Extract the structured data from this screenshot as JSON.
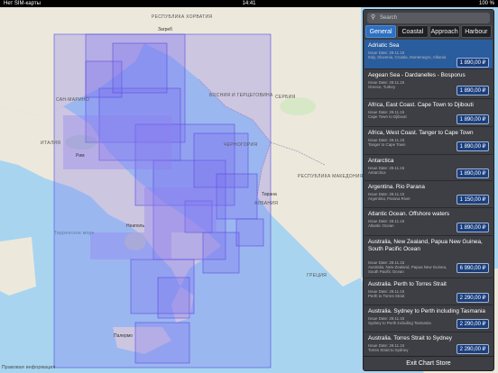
{
  "status_bar": {
    "carrier": "Нет SIM-карты",
    "time": "14:41",
    "battery": "100 %"
  },
  "map": {
    "countries": [
      "РЕСПУБЛИКА ХОРВАТИЯ",
      "БОСНИЯ И ГЕРЦЕГОВИНА",
      "СЕРБИЯ",
      "ИТАЛИЯ",
      "САН-МАРИНО",
      "ЧЕРНОГОРИЯ",
      "РЕСПУБЛИКА МАКЕДОНИЯ",
      "АЛБАНИЯ",
      "ГРЕЦИЯ"
    ],
    "cities": [
      "Загреб",
      "Рим",
      "Неаполь",
      "Тирана",
      "Палермо",
      "Тирренское море"
    ],
    "legal": "Правовая информация"
  },
  "panel": {
    "search_placeholder": "Search",
    "tabs": [
      "General",
      "Coastal",
      "Approach",
      "Harbour"
    ],
    "items": [
      {
        "title": "Adriatic Sea",
        "date": "Issue Date: 29.11.15",
        "desc": "Italy, Slovenia, Croatia, Montenegro, Albania",
        "price": "1 890,00 ₽"
      },
      {
        "title": "Aegean Sea - Dardanelles - Bosporus",
        "date": "Issue Date: 29.11.15",
        "desc": "Greece, Turkey",
        "price": "1 890,00 ₽"
      },
      {
        "title": "Africa, East Coast. Cape Town to Djibouti",
        "date": "Issue Date: 29.11.15",
        "desc": "Cape Town to Djibouti",
        "price": "1 890,00 ₽"
      },
      {
        "title": "Africa, West Coast. Tanger to Cape Town",
        "date": "Issue Date: 29.11.15",
        "desc": "Tanger to Cape Town",
        "price": "1 890,00 ₽"
      },
      {
        "title": "Antarctica",
        "date": "Issue Date: 29.11.15",
        "desc": "Antarctica",
        "price": "1 890,00 ₽"
      },
      {
        "title": "Argentina. Rio Parana",
        "date": "Issue Date: 29.11.15",
        "desc": "Argentina, Parana River",
        "price": "1 150,00 ₽"
      },
      {
        "title": "Atlantic Ocean. Offshore waters",
        "date": "Issue Date: 29.11.15",
        "desc": "Atlantic Ocean",
        "price": "1 890,00 ₽"
      },
      {
        "title": "Australia, New Zealand, Papua New Guinea, South Pacific Ocean",
        "date": "Issue Date: 29.11.15",
        "desc": "Australia, New Zealand, Papua New Guinea, South Pacific Ocean",
        "price": "6 990,00 ₽"
      },
      {
        "title": "Australia. Perth to Torres Strait",
        "date": "Issue Date: 29.11.15",
        "desc": "Perth to Torres Strait",
        "price": "2 290,00 ₽"
      },
      {
        "title": "Australia. Sydney to Perth including Tasmania",
        "date": "Issue Date: 29.11.15",
        "desc": "Sydney to Perth including Tasmania",
        "price": "2 290,00 ₽"
      },
      {
        "title": "Australia. Torres Strait to Sydney",
        "date": "Issue Date: 29.11.15",
        "desc": "Torres Strait to Sydney",
        "price": "2 290,00 ₽"
      }
    ],
    "exit_label": "Exit Chart Store"
  }
}
